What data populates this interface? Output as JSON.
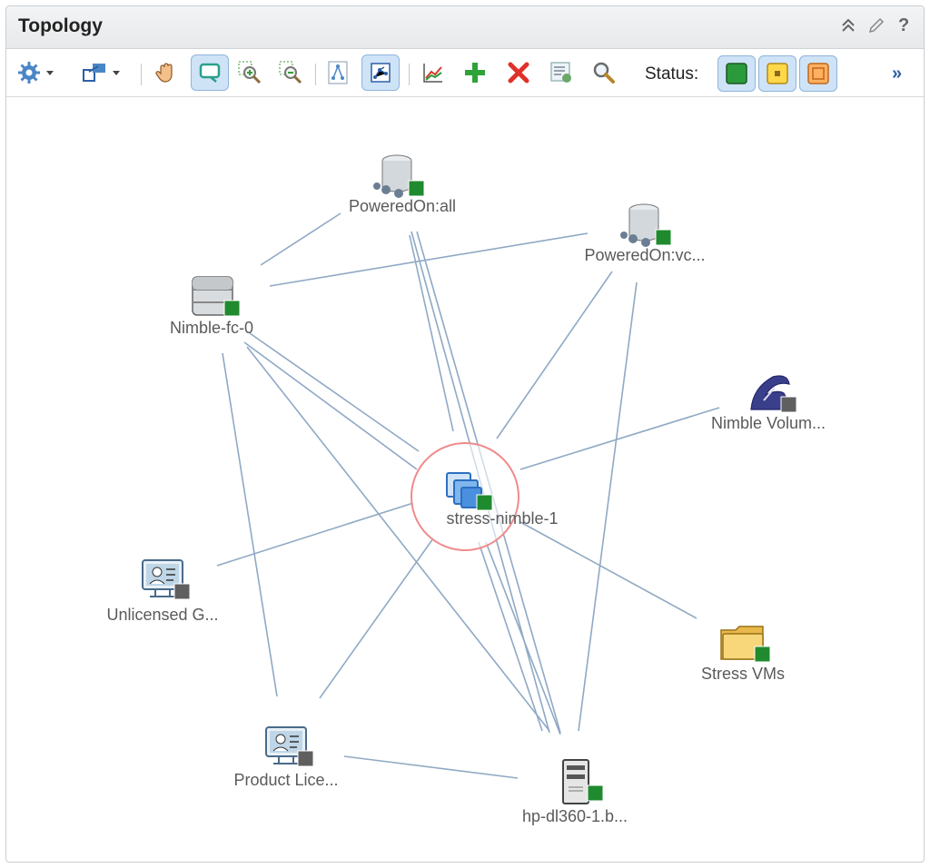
{
  "panel": {
    "title": "Topology"
  },
  "title_actions": [
    {
      "name": "collapse-icon",
      "glyph": "⌃"
    },
    {
      "name": "edit-icon",
      "glyph": "✎"
    },
    {
      "name": "help-icon",
      "glyph": "?"
    }
  ],
  "toolbar": {
    "status_label": "Status:",
    "more_glyph": "»"
  },
  "nodes": [
    {
      "id": "stress-nimble-1",
      "label": "stress-nimble-1",
      "icon": "vm-icon",
      "status": "green",
      "selected": true
    },
    {
      "id": "poweredon-all",
      "label": "PoweredOn:all",
      "icon": "datastore-icon",
      "status": "green"
    },
    {
      "id": "poweredon-vc",
      "label": "PoweredOn:vc...",
      "icon": "datastore-icon",
      "status": "green"
    },
    {
      "id": "nimble-fc-0",
      "label": "Nimble-fc-0",
      "icon": "storage-array-icon",
      "status": "green"
    },
    {
      "id": "nimble-volume",
      "label": "Nimble Volum...",
      "icon": "volume-icon",
      "status": "gray"
    },
    {
      "id": "unlicensed",
      "label": "Unlicensed G...",
      "icon": "license-icon",
      "status": "gray"
    },
    {
      "id": "stress-vms",
      "label": "Stress VMs",
      "icon": "folder-icon",
      "status": "green"
    },
    {
      "id": "product-license",
      "label": "Product Lice...",
      "icon": "license-icon",
      "status": "gray"
    },
    {
      "id": "hp-dl360",
      "label": "hp-dl360-1.b...",
      "icon": "server-icon",
      "status": "green"
    }
  ],
  "colors": {
    "edge": "#8fa9c4",
    "status_green": "#1f8a2e",
    "status_gray": "#5f5f5f",
    "selection_ring": "#f08a8a",
    "accent": "#2d5fa8"
  }
}
